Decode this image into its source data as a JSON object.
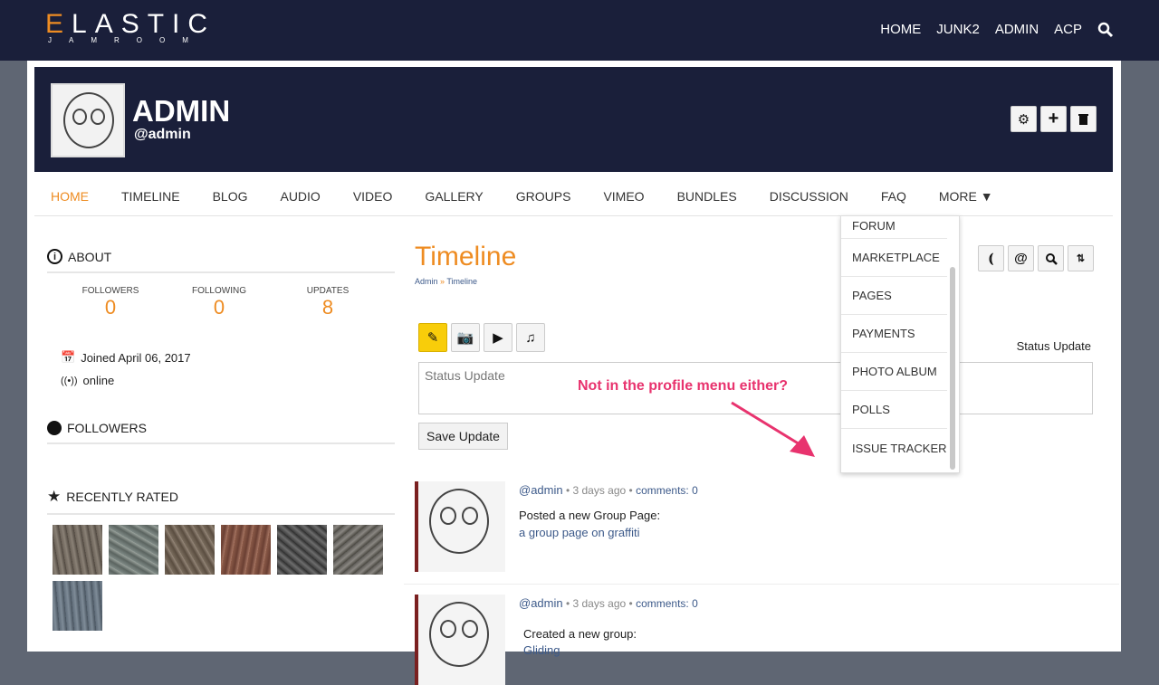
{
  "site": {
    "logo_initial": "E",
    "logo_rest": "LASTIC",
    "logo_sub": "JAMROOM"
  },
  "topnav": [
    "HOME",
    "JUNK2",
    "ADMIN",
    "ACP"
  ],
  "profile": {
    "name": "ADMIN",
    "handle": "@admin"
  },
  "nav": [
    "HOME",
    "TIMELINE",
    "BLOG",
    "AUDIO",
    "VIDEO",
    "GALLERY",
    "GROUPS",
    "VIMEO",
    "BUNDLES",
    "DISCUSSION",
    "FAQ",
    "MORE ▼"
  ],
  "dropdown": [
    "FORUM",
    "MARKETPLACE",
    "PAGES",
    "PAYMENTS",
    "PHOTO ALBUM",
    "POLLS",
    "ISSUE TRACKER"
  ],
  "about": {
    "title": "ABOUT",
    "stats": [
      {
        "label": "FOLLOWERS",
        "value": "0"
      },
      {
        "label": "FOLLOWING",
        "value": "0"
      },
      {
        "label": "UPDATES",
        "value": "8"
      }
    ],
    "joined": "Joined April 06, 2017",
    "status": "online"
  },
  "followers_title": "FOLLOWERS",
  "rated_title": "RECENTLY RATED",
  "main": {
    "title": "Timeline",
    "crumb_a": "Admin",
    "crumb_sep": "»",
    "crumb_b": "Timeline",
    "status_label": "Status Update",
    "placeholder": "Status Update",
    "save": "Save Update"
  },
  "entries": [
    {
      "user": "@admin",
      "time": "3 days ago",
      "comments": "comments: 0",
      "text": "Posted a new Group Page:",
      "link": "a group page on graffiti"
    },
    {
      "user": "@admin",
      "time": "3 days ago",
      "comments": "comments: 0",
      "text": "Created a new group:",
      "link": "Gliding"
    }
  ],
  "annotation": "Not in the profile menu either?",
  "colors": {
    "accent": "#ee8c22",
    "dark": "#1a1f3a",
    "link": "#3d5a8a",
    "annotation": "#e8336e"
  }
}
